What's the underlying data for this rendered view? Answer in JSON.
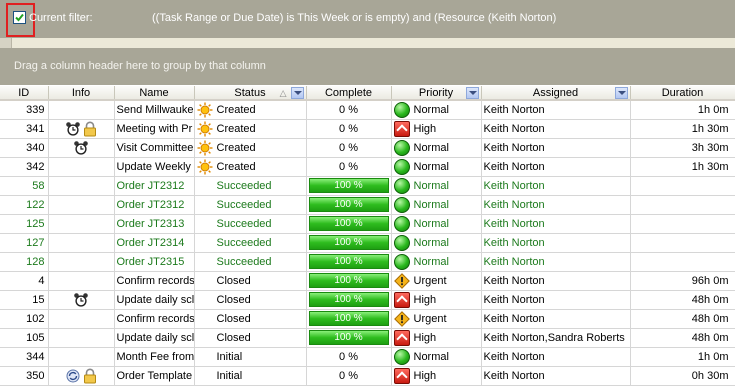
{
  "filter": {
    "label": "Current filter:",
    "text": "((Task Range or Due Date) is This Week or is empty) and (Resource  (Keith Norton)"
  },
  "group_panel": {
    "hint": "Drag a column header here to group by that column"
  },
  "columns": [
    "ID",
    "Info",
    "Name",
    "Status",
    "Complete",
    "Priority",
    "Assigned",
    "Duration"
  ],
  "colors": {
    "panel": "#a8a697",
    "succeeded_text": "#1c7a1c",
    "progress_bar": "#2fbd1f"
  },
  "rows": [
    {
      "id": "339",
      "info": [],
      "name": "Send Millwaukee",
      "status": "Created",
      "status_icon": "sun-icon",
      "complete": "0 %",
      "complete_pct": 0,
      "priority": "Normal",
      "assigned": "Keith Norton",
      "duration": "1h 0m",
      "green": false
    },
    {
      "id": "341",
      "info": [
        "alarm-clock-icon",
        "lock-icon"
      ],
      "name": "Meeting with Pr",
      "status": "Created",
      "status_icon": "sun-icon",
      "complete": "0 %",
      "complete_pct": 0,
      "priority": "High",
      "assigned": "Keith Norton",
      "duration": "1h 30m",
      "green": false
    },
    {
      "id": "340",
      "info": [
        "alarm-clock-icon"
      ],
      "name": "Visit Committee",
      "status": "Created",
      "status_icon": "sun-icon",
      "complete": "0 %",
      "complete_pct": 0,
      "priority": "Normal",
      "assigned": "Keith Norton",
      "duration": "3h 30m",
      "green": false
    },
    {
      "id": "342",
      "info": [],
      "name": "Update Weekly",
      "status": "Created",
      "status_icon": "sun-icon",
      "complete": "0 %",
      "complete_pct": 0,
      "priority": "Normal",
      "assigned": "Keith Norton",
      "duration": "1h 30m",
      "green": false
    },
    {
      "id": "58",
      "info": [],
      "name": "Order JT2312",
      "status": "Succeeded",
      "status_icon": "",
      "complete": "100 %",
      "complete_pct": 100,
      "priority": "Normal",
      "assigned": "Keith Norton",
      "duration": "",
      "green": true
    },
    {
      "id": "122",
      "info": [],
      "name": "Order JT2312",
      "status": "Succeeded",
      "status_icon": "",
      "complete": "100 %",
      "complete_pct": 100,
      "priority": "Normal",
      "assigned": "Keith Norton",
      "duration": "",
      "green": true
    },
    {
      "id": "125",
      "info": [],
      "name": "Order JT2313",
      "status": "Succeeded",
      "status_icon": "",
      "complete": "100 %",
      "complete_pct": 100,
      "priority": "Normal",
      "assigned": "Keith Norton",
      "duration": "",
      "green": true
    },
    {
      "id": "127",
      "info": [],
      "name": "Order JT2314",
      "status": "Succeeded",
      "status_icon": "",
      "complete": "100 %",
      "complete_pct": 100,
      "priority": "Normal",
      "assigned": "Keith Norton",
      "duration": "",
      "green": true
    },
    {
      "id": "128",
      "info": [],
      "name": "Order JT2315",
      "status": "Succeeded",
      "status_icon": "",
      "complete": "100 %",
      "complete_pct": 100,
      "priority": "Normal",
      "assigned": "Keith Norton",
      "duration": "",
      "green": true
    },
    {
      "id": "4",
      "info": [],
      "name": "Confirm records",
      "status": "Closed",
      "status_icon": "",
      "complete": "100 %",
      "complete_pct": 100,
      "priority": "Urgent",
      "assigned": "Keith Norton",
      "duration": "96h 0m",
      "green": false
    },
    {
      "id": "15",
      "info": [
        "alarm-clock-icon"
      ],
      "name": "Update daily scl",
      "status": "Closed",
      "status_icon": "",
      "complete": "100 %",
      "complete_pct": 100,
      "priority": "High",
      "assigned": "Keith Norton",
      "duration": "48h 0m",
      "green": false
    },
    {
      "id": "102",
      "info": [],
      "name": "Confirm records",
      "status": "Closed",
      "status_icon": "",
      "complete": "100 %",
      "complete_pct": 100,
      "priority": "Urgent",
      "assigned": "Keith Norton",
      "duration": "48h 0m",
      "green": false
    },
    {
      "id": "105",
      "info": [],
      "name": "Update daily scl",
      "status": "Closed",
      "status_icon": "",
      "complete": "100 %",
      "complete_pct": 100,
      "priority": "High",
      "assigned": "Keith Norton,Sandra Roberts",
      "duration": "48h 0m",
      "green": false
    },
    {
      "id": "344",
      "info": [],
      "name": "Month Fee from",
      "status": "Initial",
      "status_icon": "",
      "complete": "0 %",
      "complete_pct": 0,
      "priority": "Normal",
      "assigned": "Keith Norton",
      "duration": "1h 0m",
      "green": false
    },
    {
      "id": "350",
      "info": [
        "recurrence-icon",
        "lock-icon"
      ],
      "name": "Order Template",
      "status": "Initial",
      "status_icon": "",
      "complete": "0 %",
      "complete_pct": 0,
      "priority": "High",
      "assigned": "Keith Norton",
      "duration": "0h 30m",
      "green": false
    }
  ]
}
